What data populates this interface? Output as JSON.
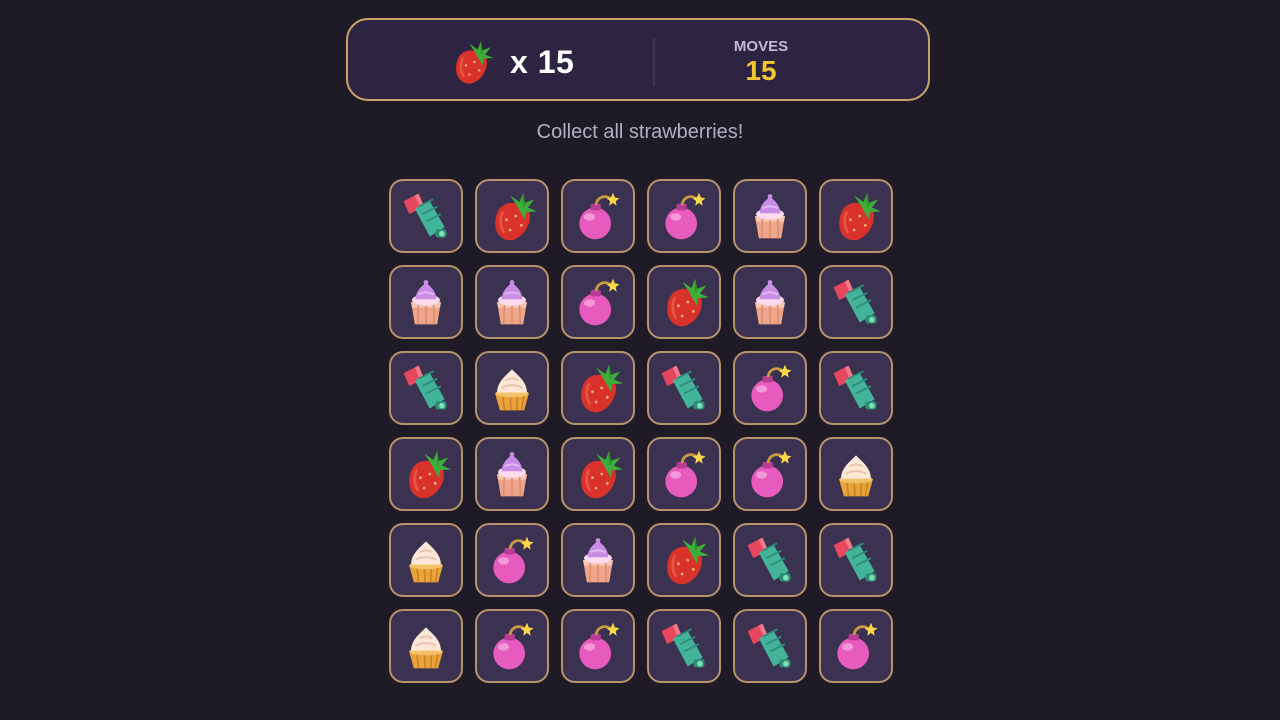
{
  "hud": {
    "goal_icon": "strawberry-icon",
    "goal_count": "x 15",
    "moves_label": "MOVES",
    "moves_value": "15"
  },
  "instruction": "Collect all strawberries!",
  "colors": {
    "background": "#1e1a26",
    "panel": "#2c2440",
    "tile": "#3b3150",
    "border_gold": "#c9a46a",
    "moves_value": "#f3c531"
  },
  "board": {
    "rows": 6,
    "cols": 6,
    "grid": [
      [
        "firework",
        "strawberry",
        "bomb",
        "bomb",
        "cupcake",
        "strawberry"
      ],
      [
        "cupcake",
        "cupcake",
        "bomb",
        "strawberry",
        "cupcake",
        "firework"
      ],
      [
        "firework",
        "cream-tart",
        "strawberry",
        "firework",
        "bomb",
        "firework"
      ],
      [
        "strawberry",
        "cupcake",
        "strawberry",
        "bomb",
        "bomb",
        "cream-tart"
      ],
      [
        "cream-tart",
        "bomb",
        "cupcake",
        "strawberry",
        "firework",
        "firework"
      ],
      [
        "cream-tart",
        "bomb",
        "bomb",
        "firework",
        "firework",
        "bomb"
      ]
    ]
  }
}
